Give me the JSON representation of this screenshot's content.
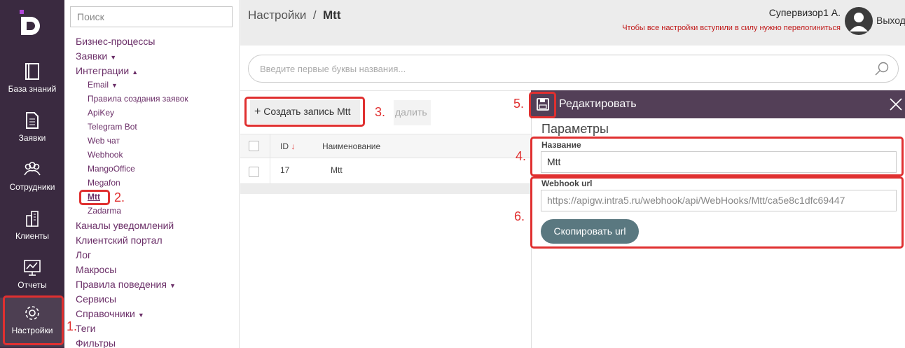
{
  "rail": {
    "items": [
      {
        "label": "База знаний",
        "icon": "book-icon"
      },
      {
        "label": "Заявки",
        "icon": "document-icon"
      },
      {
        "label": "Сотрудники",
        "icon": "users-icon"
      },
      {
        "label": "Клиенты",
        "icon": "buildings-icon"
      },
      {
        "label": "Отчеты",
        "icon": "chart-icon"
      },
      {
        "label": "Настройки",
        "icon": "gear-icon",
        "active": true
      }
    ]
  },
  "tree": {
    "search_placeholder": "Поиск",
    "items": [
      {
        "label": "Бизнес-процессы",
        "level": 1
      },
      {
        "label": "Заявки",
        "level": 1,
        "caret": "▼"
      },
      {
        "label": "Интеграции",
        "level": 1,
        "caret": "▲"
      },
      {
        "label": "Email",
        "level": 2,
        "caret": "▼"
      },
      {
        "label": "Правила создания заявок",
        "level": 2
      },
      {
        "label": "ApiKey",
        "level": 2
      },
      {
        "label": "Telegram Bot",
        "level": 2
      },
      {
        "label": "Web чат",
        "level": 2
      },
      {
        "label": "Webhook",
        "level": 2
      },
      {
        "label": "MangoOffice",
        "level": 2
      },
      {
        "label": "Megafon",
        "level": 2
      },
      {
        "label": "Mtt",
        "level": 2,
        "selected": true
      },
      {
        "label": "Zadarma",
        "level": 2
      },
      {
        "label": "Каналы уведомлений",
        "level": 1
      },
      {
        "label": "Клиентский портал",
        "level": 1
      },
      {
        "label": "Лог",
        "level": 1
      },
      {
        "label": "Макросы",
        "level": 1
      },
      {
        "label": "Правила поведения",
        "level": 1,
        "caret": "▼"
      },
      {
        "label": "Сервисы",
        "level": 1
      },
      {
        "label": "Справочники",
        "level": 1,
        "caret": "▼"
      },
      {
        "label": "Теги",
        "level": 1
      },
      {
        "label": "Фильтры",
        "level": 1
      }
    ]
  },
  "header": {
    "breadcrumb_root": "Настройки",
    "breadcrumb_sep": "/",
    "breadcrumb_current": "Mtt",
    "user_name": "Супервизор1 А.",
    "notice": "Чтобы все настройки вступили в силу нужно перелогиниться",
    "logout": "Выход"
  },
  "search": {
    "placeholder": "Введите первые буквы названия..."
  },
  "toolbar": {
    "create_label": "Создать запись Mtt",
    "delete_label": "далить"
  },
  "grid": {
    "columns": [
      "ID",
      "Наименование"
    ],
    "rows": [
      {
        "id": "17",
        "name": "Mtt"
      }
    ]
  },
  "panel": {
    "title": "Редактировать",
    "section": "Параметры",
    "name_label": "Название",
    "name_value": "Mtt",
    "webhook_label": "Webhook url",
    "webhook_value": "https://apigw.intra5.ru/webhook/api/WebHooks/Mtt/ca5e8c1dfc69447",
    "copy_label": "Скопировать url"
  },
  "annotations": [
    "1.",
    "2.",
    "3.",
    "4.",
    "5.",
    "6."
  ],
  "colors": {
    "rail": "#3a2a40",
    "accent": "#6b2f68",
    "panel_head": "#533f57",
    "annotation": "#e03030",
    "copy_button": "#5a7880"
  }
}
